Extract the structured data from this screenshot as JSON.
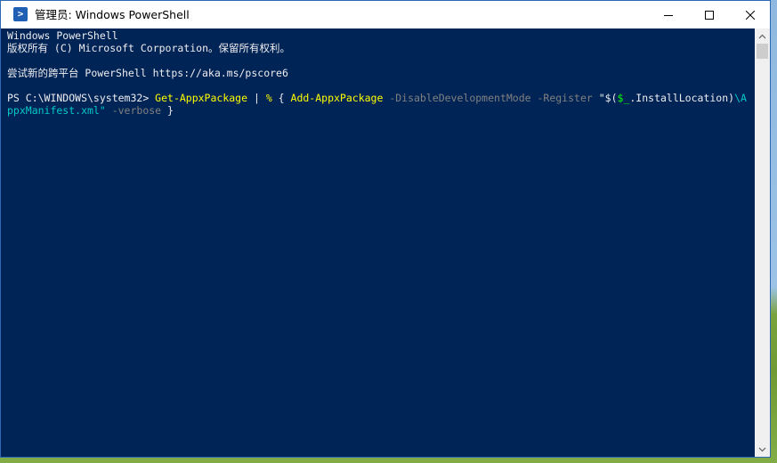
{
  "window": {
    "title": "管理员: Windows PowerShell",
    "icon": "powershell-icon",
    "controls": {
      "minimize_icon": "minimize-icon",
      "maximize_icon": "maximize-icon",
      "close_icon": "close-icon"
    }
  },
  "console": {
    "banner": {
      "line1": "Windows PowerShell",
      "line2": "版权所有 (C) Microsoft Corporation。保留所有权利。",
      "line3": "尝试新的跨平台 PowerShell https://aka.ms/pscore6"
    },
    "command": {
      "prompt": "PS C:\\WINDOWS\\system32> ",
      "cmdlet1": "Get-AppxPackage",
      "pipe": " | ",
      "alias": "%",
      "brace_open": " { ",
      "cmdlet2": "Add-AppxPackage",
      "param1": " -DisableDevelopmentMode",
      "param2": " -Register ",
      "str_open": "\"$(",
      "variable": "$_",
      "member": ".InstallLocation)",
      "str_tail1": "\\A",
      "str_tail2": "ppxManifest.xml\"",
      "param3": " -verbose",
      "brace_close": " }"
    }
  },
  "colors": {
    "console_bg": "#012456",
    "console_fg": "#eeedf0",
    "cmdlet": "#ffff00",
    "parameter": "#808080",
    "string": "#00c8c8",
    "variable": "#00ff00"
  }
}
